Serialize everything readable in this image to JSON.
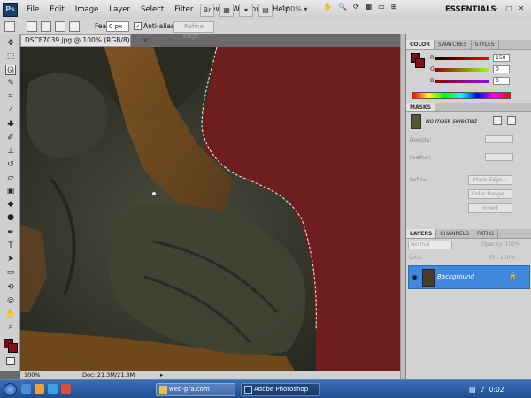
{
  "app": {
    "logo": "Ps",
    "menus": [
      "File",
      "Edit",
      "Image",
      "Layer",
      "Select",
      "Filter",
      "View",
      "Window",
      "Help"
    ],
    "zoom": "100%",
    "workspace": "ESSENTIALS",
    "win": [
      "–",
      "□",
      "✕"
    ]
  },
  "options": {
    "feather_label": "Feather:",
    "feather_value": "0 px",
    "antialias_label": "Anti-alias",
    "antialias_checked": "✓",
    "refine_label": "Refine Edge..."
  },
  "document": {
    "tab": "DSCF7039.jpg @ 100% (RGB/8)",
    "close": "×"
  },
  "status": {
    "zoom": "100%",
    "doc": "Doc: 21.3M/21.3M",
    "arrow": "▸"
  },
  "color_panel": {
    "tabs": [
      "COLOR",
      "SWATCHES",
      "STYLES"
    ],
    "r_label": "R",
    "r_value": "150",
    "g_label": "G",
    "g_value": "0",
    "b_label": "B",
    "b_value": "0",
    "accent": "#7d0a12"
  },
  "masks_panel": {
    "title": "MASKS",
    "status": "No mask selected",
    "density_label": "Density:",
    "feather_label": "Feather:",
    "refine_label": "Refine:",
    "mask_edge": "Mask Edge...",
    "color_range": "Color Range...",
    "invert": "Invert"
  },
  "layers_panel": {
    "tabs": [
      "LAYERS",
      "CHANNELS",
      "PATHS"
    ],
    "blend_mode": "Normal",
    "opacity_label": "Opacity:",
    "opacity_value": "100%",
    "lock_label": "Lock:",
    "fill_label": "Fill:",
    "fill_value": "100%",
    "layer_name": "Background",
    "selection_color": "#3f87dd"
  },
  "taskbar": {
    "item1": "web-pra.com",
    "item2": "Adobe Photoshop CS...",
    "clock": "0:02"
  }
}
